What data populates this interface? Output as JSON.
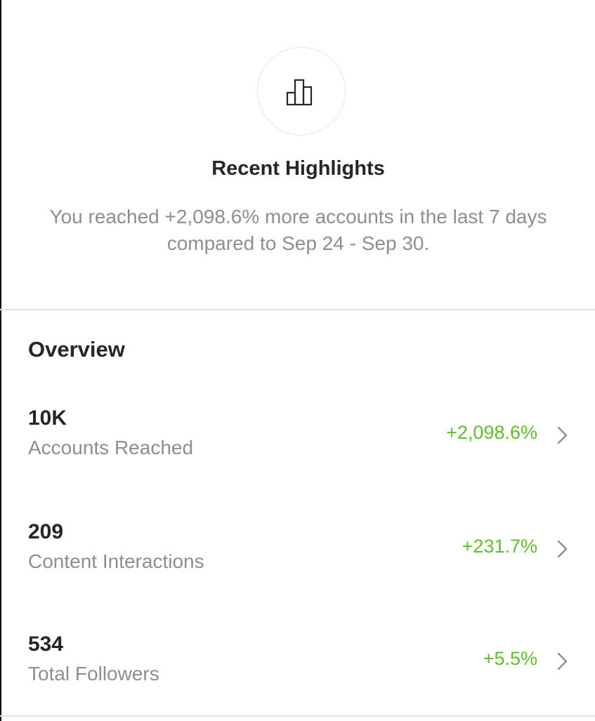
{
  "highlights": {
    "icon": "bar-chart-icon",
    "title": "Recent Highlights",
    "description": "You reached +2,098.6% more accounts in the last 7 days compared to Sep 24 - Sep 30."
  },
  "overview": {
    "title": "Overview",
    "metrics": [
      {
        "value": "10K",
        "label": "Accounts Reached",
        "change": "+2,098.6%"
      },
      {
        "value": "209",
        "label": "Content Interactions",
        "change": "+231.7%"
      },
      {
        "value": "534",
        "label": "Total Followers",
        "change": "+5.5%"
      }
    ]
  },
  "colors": {
    "positive_change": "#58c322",
    "secondary_text": "#8e8e8e",
    "primary_text": "#262626"
  }
}
